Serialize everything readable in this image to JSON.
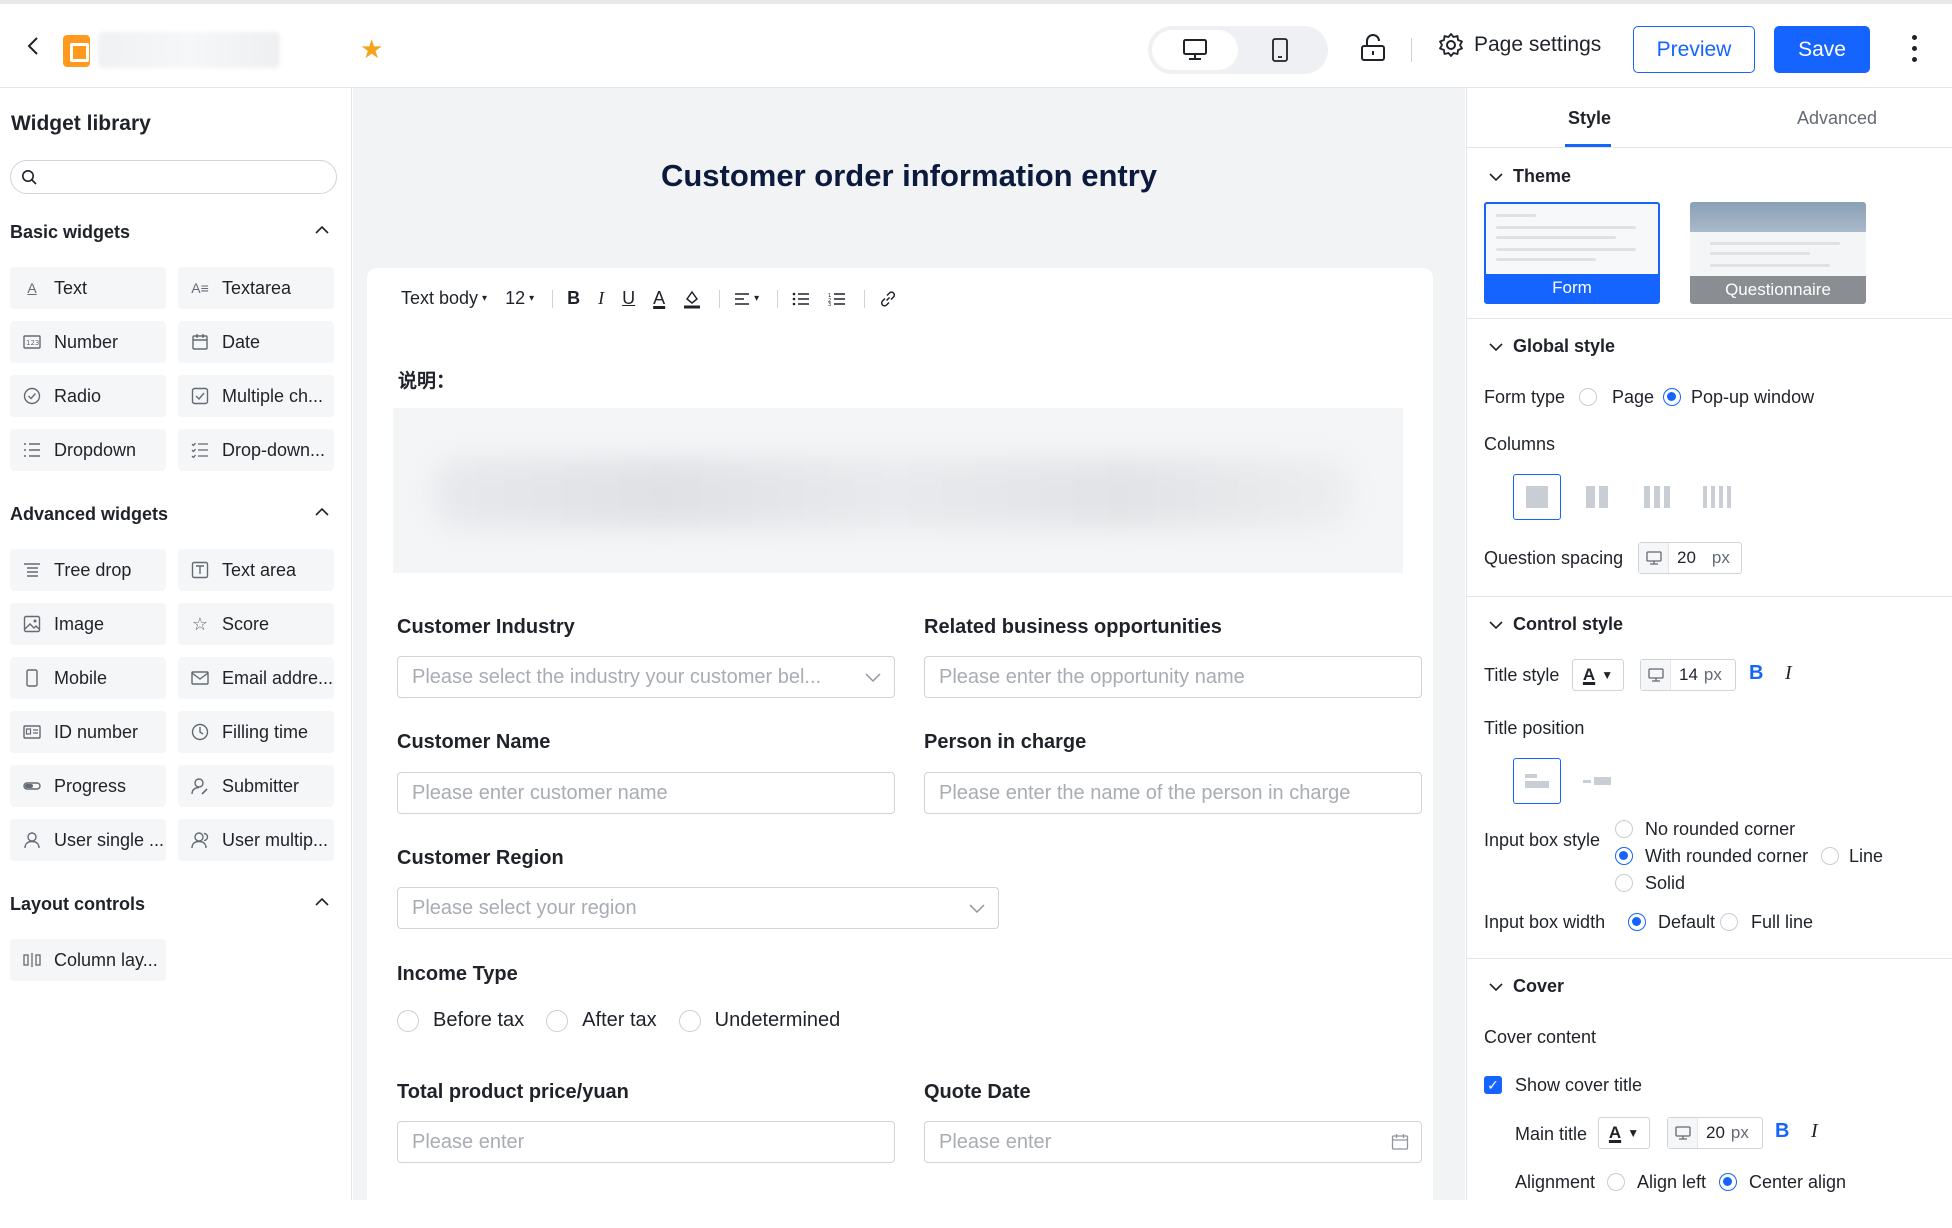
{
  "header": {
    "preview_label": "Preview",
    "save_label": "Save",
    "page_settings_label": "Page settings"
  },
  "widget_library": {
    "title": "Widget library",
    "search_placeholder": "",
    "basic": {
      "title": "Basic widgets",
      "items": [
        "Text",
        "Textarea",
        "Number",
        "Date",
        "Radio",
        "Multiple ch...",
        "Dropdown",
        "Drop-down..."
      ]
    },
    "advanced": {
      "title": "Advanced widgets",
      "items": [
        "Tree drop",
        "Text area",
        "Image",
        "Score",
        "Mobile",
        "Email addre...",
        "ID number",
        "Filling time",
        "Progress",
        "Submitter",
        "User single ...",
        "User multip..."
      ]
    },
    "layout": {
      "title": "Layout controls",
      "items": [
        "Column lay..."
      ]
    }
  },
  "form": {
    "title": "Customer order information entry",
    "toolbar": {
      "text_style": "Text body",
      "font_size": "12"
    },
    "description_label": "说明：",
    "fields": {
      "industry": {
        "label": "Customer Industry",
        "placeholder": "Please select the industry your customer bel..."
      },
      "opportunity": {
        "label": "Related business opportunities",
        "placeholder": "Please enter the opportunity name"
      },
      "name": {
        "label": "Customer Name",
        "placeholder": "Please enter customer name"
      },
      "person": {
        "label": "Person in charge",
        "placeholder": "Please enter the name of the person in charge"
      },
      "region": {
        "label": "Customer Region",
        "placeholder": "Please select your region"
      },
      "income": {
        "label": "Income Type",
        "options": [
          "Before tax",
          "After tax",
          "Undetermined"
        ]
      },
      "price": {
        "label": "Total product price/yuan",
        "placeholder": "Please enter"
      },
      "quote_date": {
        "label": "Quote Date",
        "placeholder": "Please enter"
      }
    }
  },
  "settings": {
    "tabs": [
      "Style",
      "Advanced"
    ],
    "theme": {
      "title": "Theme",
      "options": [
        "Form",
        "Questionnaire"
      ]
    },
    "global_style": {
      "title": "Global style",
      "form_type_label": "Form type",
      "form_type_options": [
        "Page",
        "Pop-up window"
      ],
      "form_type_selected": "Pop-up window",
      "columns_label": "Columns",
      "spacing_label": "Question spacing",
      "spacing_value": "20",
      "spacing_unit": "px"
    },
    "control_style": {
      "title": "Control style",
      "title_style_label": "Title style",
      "title_style_size": "14",
      "title_style_unit": "px",
      "title_position_label": "Title position",
      "input_box_style_label": "Input box style",
      "input_box_style_options": [
        "No rounded corner",
        "With rounded corner",
        "Line",
        "Solid"
      ],
      "input_box_style_selected": "With rounded corner",
      "input_box_width_label": "Input box width",
      "input_box_width_options": [
        "Default",
        "Full line"
      ],
      "input_box_width_selected": "Default"
    },
    "cover": {
      "title": "Cover",
      "content_label": "Cover content",
      "show_title_label": "Show cover title",
      "main_title_label": "Main title",
      "main_title_size": "20",
      "main_title_unit": "px",
      "alignment_label": "Alignment",
      "alignment_options": [
        "Align left",
        "Center align"
      ],
      "alignment_selected": "Center align"
    }
  },
  "colors": {
    "accent": "#1664ff",
    "brand_logo": "#ff9a1f",
    "favorite_star": "#f7a21b"
  }
}
